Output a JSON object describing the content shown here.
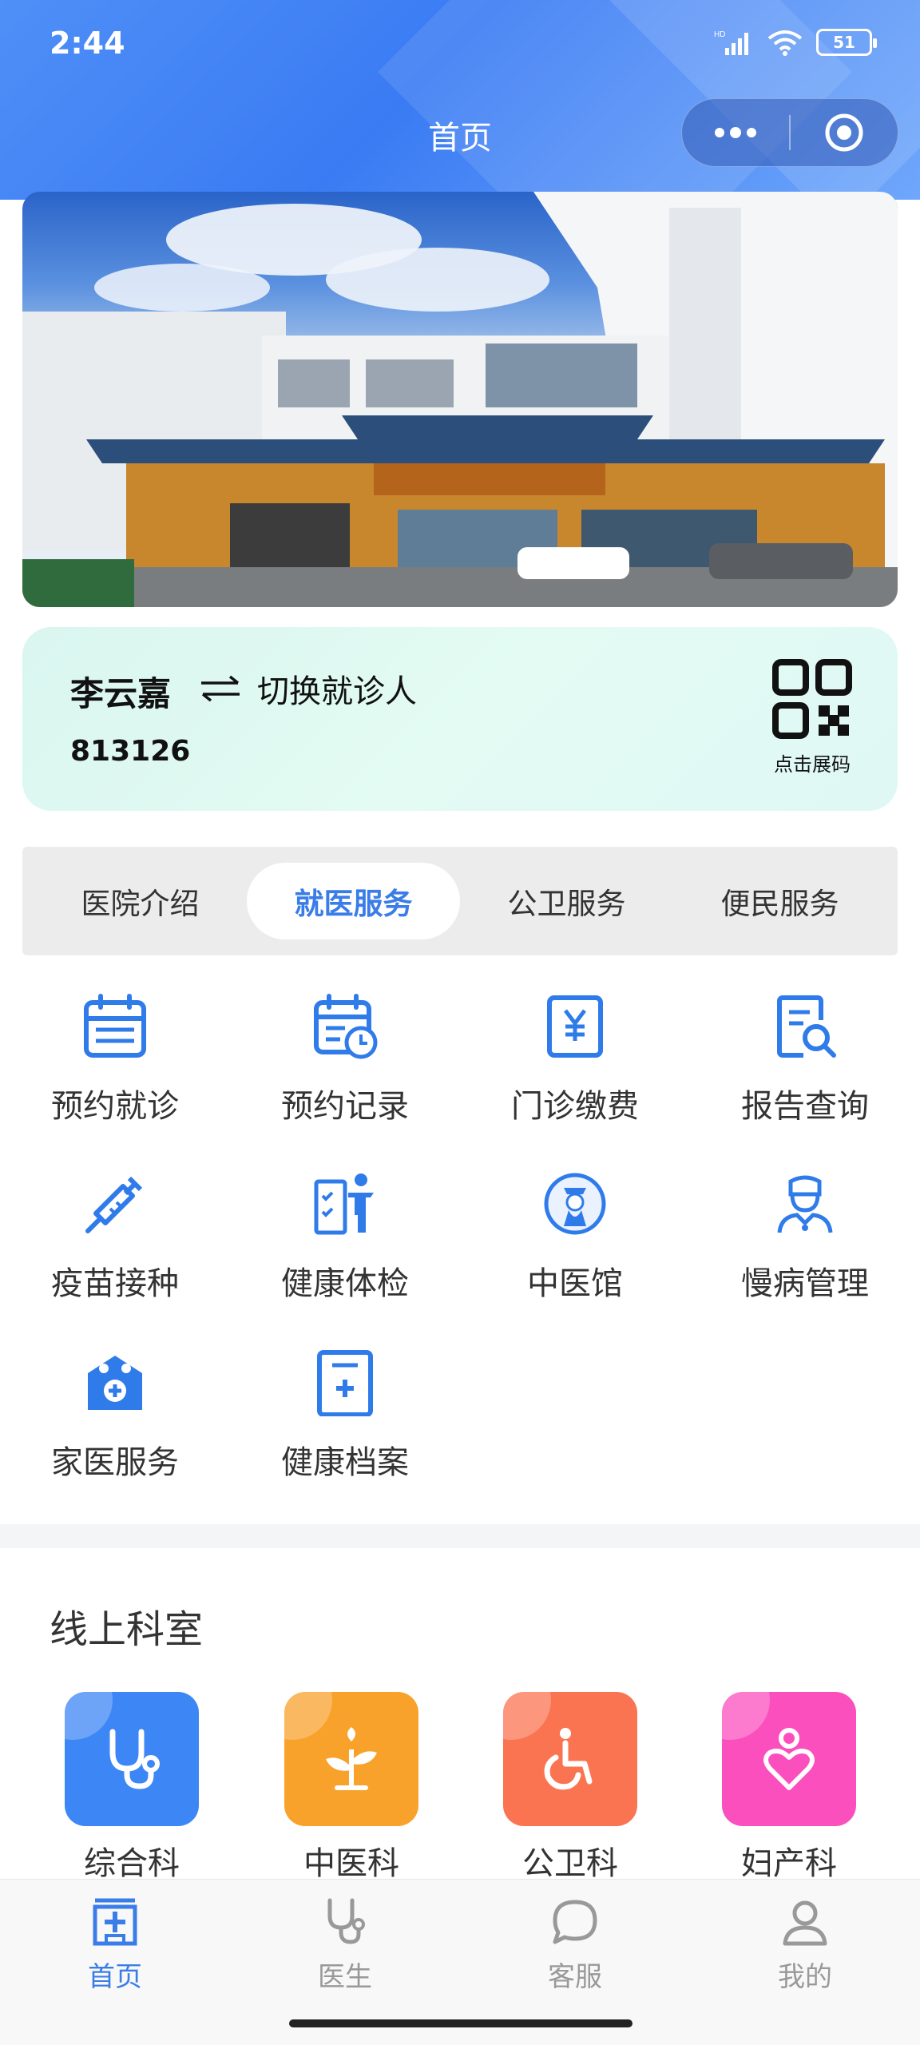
{
  "status_bar": {
    "time": "2:44",
    "signal_label": "HD",
    "battery": "51"
  },
  "nav": {
    "title": "首页"
  },
  "patient": {
    "name": "李云嘉",
    "switch_label": "切换就诊人",
    "id": "813126",
    "qr_label": "点击展码"
  },
  "tabs": [
    {
      "label": "医院介绍",
      "active": false
    },
    {
      "label": "就医服务",
      "active": true
    },
    {
      "label": "公卫服务",
      "active": false
    },
    {
      "label": "便民服务",
      "active": false
    }
  ],
  "services": [
    {
      "label": "预约就诊",
      "icon": "calendar-icon"
    },
    {
      "label": "预约记录",
      "icon": "calendar-clock-icon"
    },
    {
      "label": "门诊缴费",
      "icon": "yuan-bill-icon"
    },
    {
      "label": "报告查询",
      "icon": "report-search-icon"
    },
    {
      "label": "疫苗接种",
      "icon": "syringe-icon"
    },
    {
      "label": "健康体检",
      "icon": "checkup-icon"
    },
    {
      "label": "中医馆",
      "icon": "tcm-doctor-icon"
    },
    {
      "label": "慢病管理",
      "icon": "nurse-icon"
    },
    {
      "label": "家医服务",
      "icon": "family-doctor-icon"
    },
    {
      "label": "健康档案",
      "icon": "health-record-icon"
    }
  ],
  "section": {
    "title": "线上科室"
  },
  "departments": [
    {
      "label": "综合科",
      "icon": "stethoscope-icon",
      "color": "#3d86f6"
    },
    {
      "label": "中医科",
      "icon": "herb-icon",
      "color": "#f9a22b"
    },
    {
      "label": "公卫科",
      "icon": "wheelchair-icon",
      "color": "#fb7452"
    },
    {
      "label": "妇产科",
      "icon": "mother-icon",
      "color": "#fb4fbe"
    }
  ],
  "tabbar": [
    {
      "label": "首页",
      "icon": "hospital-icon",
      "active": true
    },
    {
      "label": "医生",
      "icon": "stethoscope-icon",
      "active": false
    },
    {
      "label": "客服",
      "icon": "chat-icon",
      "active": false
    },
    {
      "label": "我的",
      "icon": "user-icon",
      "active": false
    }
  ],
  "colors": {
    "accent": "#3a7de8",
    "header": "#4f8ff7",
    "card": "#dff8f1"
  }
}
